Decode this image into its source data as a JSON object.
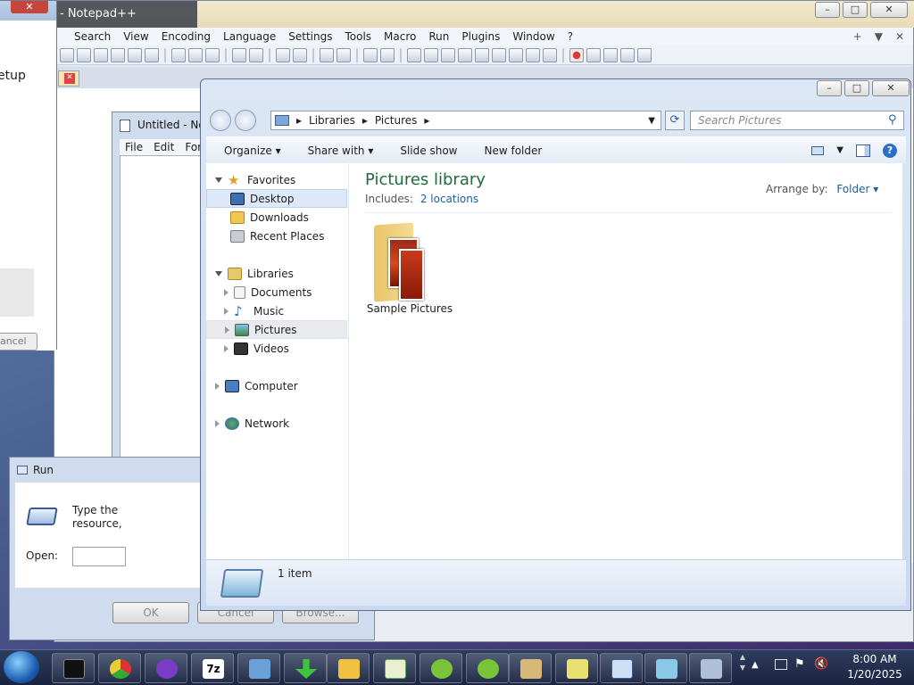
{
  "notepadpp": {
    "title": "- Notepad++",
    "menu": [
      "Search",
      "View",
      "Encoding",
      "Language",
      "Settings",
      "Tools",
      "Macro",
      "Run",
      "Plugins",
      "Window",
      "?"
    ],
    "menu_right": [
      "+",
      "▼",
      "✕"
    ]
  },
  "setup": {
    "text": "etup",
    "cancel": "ancel"
  },
  "notepad": {
    "title": "Untitled - No",
    "menu": [
      "File",
      "Edit",
      "For"
    ]
  },
  "run": {
    "title": "Run",
    "desc_line1": "Type the",
    "desc_line2": "resource,",
    "open_label": "Open:",
    "ok": "OK",
    "cancel": "Cancel",
    "browse": "Browse..."
  },
  "explorer": {
    "breadcrumb": [
      "Libraries",
      "Pictures"
    ],
    "search_placeholder": "Search Pictures",
    "commands": [
      "Organize",
      "Share with",
      "Slide show",
      "New folder"
    ],
    "nav": {
      "favorites": "Favorites",
      "desktop": "Desktop",
      "downloads": "Downloads",
      "recent": "Recent Places",
      "libraries": "Libraries",
      "documents": "Documents",
      "music": "Music",
      "pictures": "Pictures",
      "videos": "Videos",
      "computer": "Computer",
      "network": "Network"
    },
    "library_title": "Pictures library",
    "includes_label": "Includes:",
    "includes_link": "2 locations",
    "arrange_label": "Arrange by:",
    "arrange_value": "Folder",
    "folder_name": "Sample Pictures",
    "status": "1 item"
  },
  "tray": {
    "time": "8:00 AM",
    "date": "1/20/2025"
  },
  "colors": {
    "accent": "#1e5fa3",
    "title_green": "#1f6b3a",
    "selection": "#dde9f8"
  }
}
